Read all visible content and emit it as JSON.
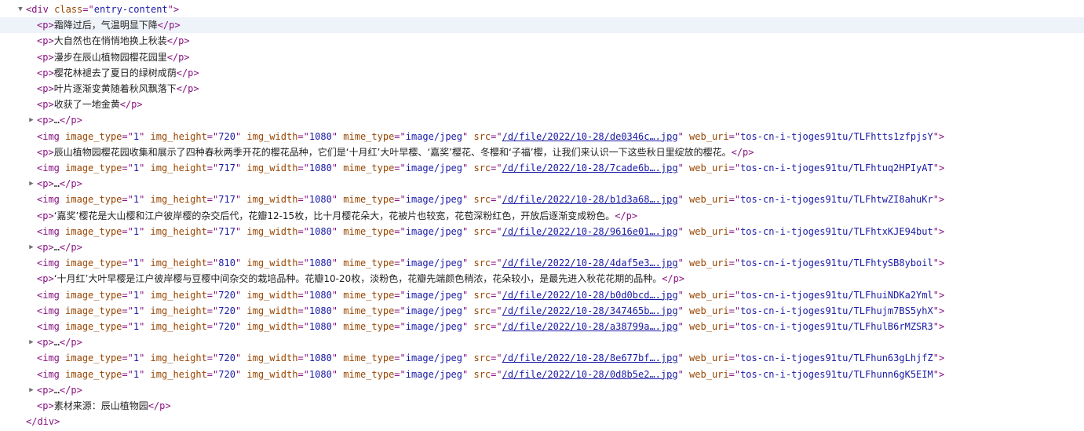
{
  "tree": {
    "rows": [
      {
        "indent": 0,
        "toggle": "expanded",
        "kind": "div_open",
        "tag": "div",
        "attr_name": "class",
        "attr_value": "entry-content"
      },
      {
        "indent": 1,
        "kind": "p",
        "text": "霜降过后，气温明显下降",
        "selected": true
      },
      {
        "indent": 1,
        "kind": "p",
        "text": "大自然也在悄悄地换上秋装"
      },
      {
        "indent": 1,
        "kind": "p",
        "text": "漫步在辰山植物园樱花园里"
      },
      {
        "indent": 1,
        "kind": "p",
        "text": "樱花林褪去了夏日的绿树成荫"
      },
      {
        "indent": 1,
        "kind": "p",
        "text": "叶片逐渐变黄随着秋风飘落下"
      },
      {
        "indent": 1,
        "kind": "p",
        "text": "收获了一地金黄"
      },
      {
        "indent": 1,
        "toggle": "collapsed",
        "kind": "p_collapsed",
        "text": "…"
      },
      {
        "indent": 1,
        "kind": "img",
        "image_type": "1",
        "img_height": "720",
        "img_width": "1080",
        "mime_type": "image/jpeg",
        "src": "/d/file/2022/10-28/de0346c….jpg",
        "web_uri": "tos-cn-i-tjoges91tu/TLFhtts1zfpjsY"
      },
      {
        "indent": 1,
        "kind": "p",
        "text": "辰山植物园樱花园收集和展示了四种春秋两季开花的樱花品种，它们是‘十月红’大叶早樱、‘嘉奖’樱花、冬樱和‘子福’樱，让我们来认识一下这些秋日里绽放的樱花。"
      },
      {
        "indent": 1,
        "kind": "img",
        "image_type": "1",
        "img_height": "717",
        "img_width": "1080",
        "mime_type": "image/jpeg",
        "src": "/d/file/2022/10-28/7cade6b….jpg",
        "web_uri": "tos-cn-i-tjoges91tu/TLFhtuq2HPIyAT"
      },
      {
        "indent": 1,
        "toggle": "collapsed",
        "kind": "p_collapsed",
        "text": "…"
      },
      {
        "indent": 1,
        "kind": "img",
        "image_type": "1",
        "img_height": "717",
        "img_width": "1080",
        "mime_type": "image/jpeg",
        "src": "/d/file/2022/10-28/b1d3a68….jpg",
        "web_uri": "tos-cn-i-tjoges91tu/TLFhtwZI8ahuKr"
      },
      {
        "indent": 1,
        "kind": "p",
        "text": "‘嘉奖’樱花是大山樱和江户彼岸樱的杂交后代，花瓣12-15枚，比十月樱花朵大，花被片也较宽，花苞深粉红色，开放后逐渐变成粉色。"
      },
      {
        "indent": 1,
        "kind": "img",
        "image_type": "1",
        "img_height": "717",
        "img_width": "1080",
        "mime_type": "image/jpeg",
        "src": "/d/file/2022/10-28/9616e01….jpg",
        "web_uri": "tos-cn-i-tjoges91tu/TLFhtxKJE94but"
      },
      {
        "indent": 1,
        "toggle": "collapsed",
        "kind": "p_collapsed",
        "text": "…"
      },
      {
        "indent": 1,
        "kind": "img",
        "image_type": "1",
        "img_height": "810",
        "img_width": "1080",
        "mime_type": "image/jpeg",
        "src": "/d/file/2022/10-28/4daf5e3….jpg",
        "web_uri": "tos-cn-i-tjoges91tu/TLFhtySB8yboil"
      },
      {
        "indent": 1,
        "kind": "p",
        "text": "‘十月红’大叶早樱是江户彼岸樱与豆樱中间杂交的栽培品种。花瓣10-20枚，淡粉色，花瓣先端颜色稍浓，花朵较小，是最先进入秋花花期的品种。"
      },
      {
        "indent": 1,
        "kind": "img",
        "image_type": "1",
        "img_height": "720",
        "img_width": "1080",
        "mime_type": "image/jpeg",
        "src": "/d/file/2022/10-28/b0d0bcd….jpg",
        "web_uri": "tos-cn-i-tjoges91tu/TLFhuiNDKa2Yml"
      },
      {
        "indent": 1,
        "kind": "img",
        "image_type": "1",
        "img_height": "720",
        "img_width": "1080",
        "mime_type": "image/jpeg",
        "src": "/d/file/2022/10-28/347465b….jpg",
        "web_uri": "tos-cn-i-tjoges91tu/TLFhujm7BS5yhX"
      },
      {
        "indent": 1,
        "kind": "img",
        "image_type": "1",
        "img_height": "720",
        "img_width": "1080",
        "mime_type": "image/jpeg",
        "src": "/d/file/2022/10-28/a38799a….jpg",
        "web_uri": "tos-cn-i-tjoges91tu/TLFhulB6rMZSR3"
      },
      {
        "indent": 1,
        "toggle": "collapsed",
        "kind": "p_collapsed",
        "text": "…"
      },
      {
        "indent": 1,
        "kind": "img",
        "image_type": "1",
        "img_height": "720",
        "img_width": "1080",
        "mime_type": "image/jpeg",
        "src": "/d/file/2022/10-28/8e677bf….jpg",
        "web_uri": "tos-cn-i-tjoges91tu/TLFhun63gLhjfZ"
      },
      {
        "indent": 1,
        "kind": "img",
        "image_type": "1",
        "img_height": "720",
        "img_width": "1080",
        "mime_type": "image/jpeg",
        "src": "/d/file/2022/10-28/0d8b5e2….jpg",
        "web_uri": "tos-cn-i-tjoges91tu/TLFhunn6gK5EIM"
      },
      {
        "indent": 1,
        "toggle": "collapsed",
        "kind": "p_collapsed",
        "text": "…"
      },
      {
        "indent": 1,
        "kind": "p",
        "text": "素材来源：辰山植物园"
      },
      {
        "indent": 0,
        "kind": "div_close",
        "tag": "div"
      }
    ]
  },
  "colors": {
    "tag": "#881280",
    "attr_name": "#994500",
    "attr_value": "#1a1aa6",
    "selected_row": "#eef2f9"
  },
  "icons": {
    "expanded": "triangle-down-icon",
    "collapsed": "triangle-right-icon"
  }
}
